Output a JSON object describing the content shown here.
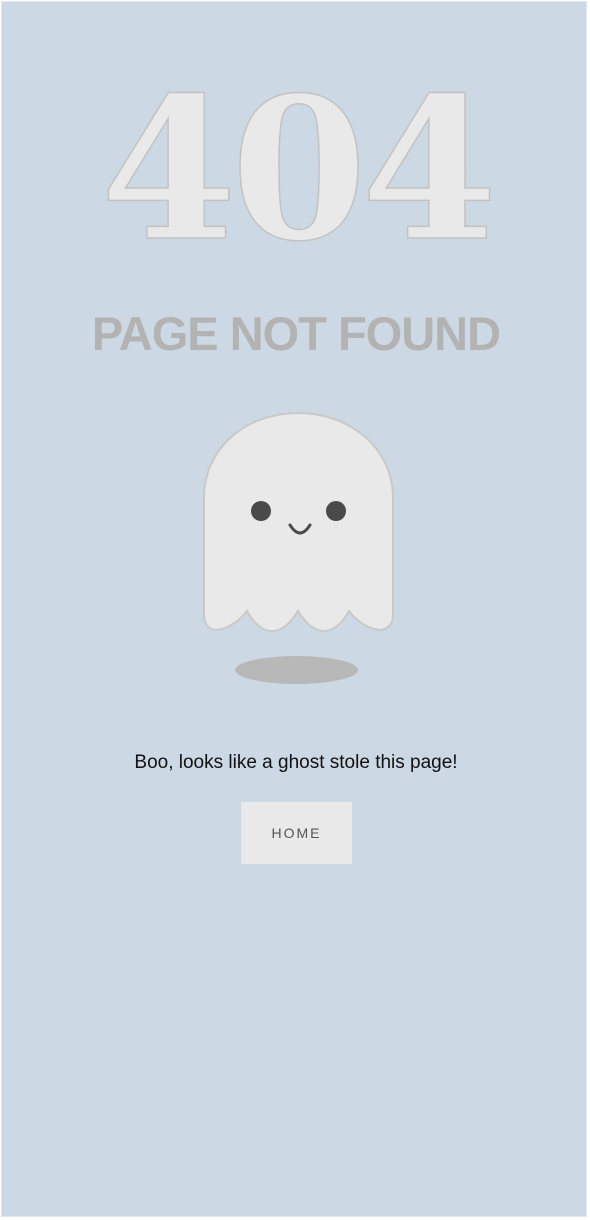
{
  "error": {
    "code": "404",
    "heading": "PAGE NOT FOUND",
    "message": "Boo, looks like a ghost stole this page!"
  },
  "actions": {
    "home_label": "HOME"
  },
  "illustration": {
    "icon": "ghost-icon",
    "body_color": "#e9e9e9",
    "eye_color": "#4a4a4a",
    "shadow_color": "#b8b8b8"
  },
  "colors": {
    "background": "#cdd8e5",
    "heading": "#b3b3b3",
    "code_fill": "#e9e9e9",
    "button_bg": "#e9e9e9"
  }
}
